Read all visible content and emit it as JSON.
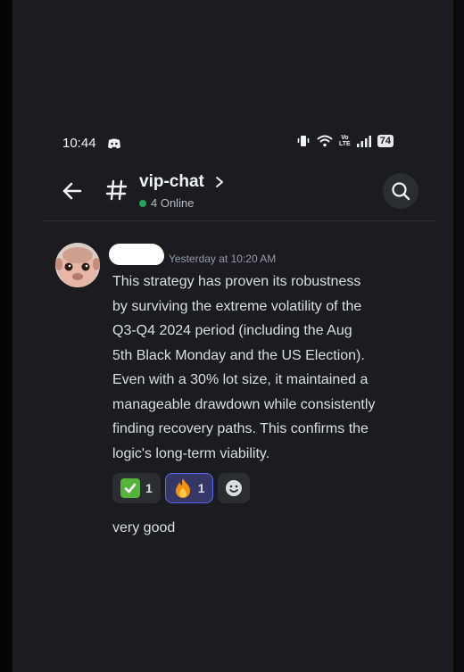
{
  "status_bar": {
    "time": "10:44",
    "battery": "74",
    "network": "Vo LTE"
  },
  "header": {
    "channel_name": "vip-chat",
    "online_count": "4 Online"
  },
  "message": {
    "timestamp": "Yesterday at 10:20 AM",
    "lines": [
      "This strategy has proven its robustness",
      "by surviving the extreme volatility of the",
      "Q3-Q4 2024 period (including the Aug",
      "5th Black Monday and the US Election).",
      "Even with a 30% lot size, it maintained a",
      "manageable drawdown while consistently",
      "finding recovery paths. This confirms the",
      "logic's long-term viability."
    ],
    "reactions": [
      {
        "emoji": "check-mark-icon",
        "count": "1",
        "active": false
      },
      {
        "emoji": "fire-icon",
        "count": "1",
        "active": true
      }
    ]
  },
  "followup_message": {
    "text": "very good"
  },
  "colors": {
    "background": "#1c1c20",
    "online": "#23a55a",
    "accent": "#5865f2",
    "text": "#dbdee1",
    "muted": "#949ba4"
  }
}
